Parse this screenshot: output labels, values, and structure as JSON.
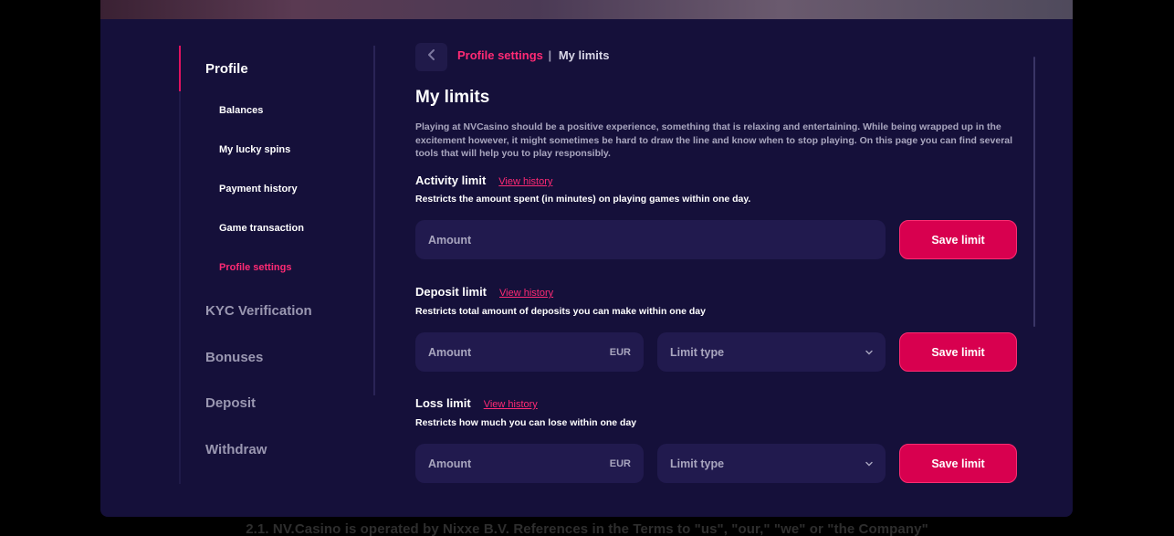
{
  "sidebar": {
    "profile": "Profile",
    "sub_items": [
      {
        "label": "Balances",
        "active": false
      },
      {
        "label": "My lucky spins",
        "active": false
      },
      {
        "label": "Payment history",
        "active": false
      },
      {
        "label": "Game transaction",
        "active": false
      },
      {
        "label": "Profile settings",
        "active": true
      }
    ],
    "main_items": [
      "KYC Verification",
      "Bonuses",
      "Deposit",
      "Withdraw"
    ]
  },
  "breadcrumb": {
    "parent": "Profile settings",
    "separator": "|",
    "current": "My limits"
  },
  "page": {
    "title": "My limits",
    "intro": "Playing at NVCasino should be a positive experience, something that is relaxing and entertaining. While being wrapped up in the excitement however, it might sometimes be hard to draw the line and know when to stop playing. On this page you can find several tools that will help you to play responsibly."
  },
  "sections": {
    "activity": {
      "title": "Activity limit",
      "history": "View history",
      "desc": "Restricts the amount spent (in minutes) on playing games within one day.",
      "amount_placeholder": "Amount",
      "save": "Save limit"
    },
    "deposit": {
      "title": "Deposit limit",
      "history": "View history",
      "desc": "Restricts total amount of deposits you can make within one day",
      "amount_placeholder": "Amount",
      "currency": "EUR",
      "limit_type": "Limit type",
      "save": "Save limit"
    },
    "loss": {
      "title": "Loss limit",
      "history": "View history",
      "desc": "Restricts how much you can lose within one day",
      "amount_placeholder": "Amount",
      "currency": "EUR",
      "limit_type": "Limit type",
      "save": "Save limit"
    }
  },
  "footer": {
    "text": "2.1. NV.Casino is operated by Nixxe B.V. References in the Terms to \"us\", \"our,\" \"we\" or \"the Company\""
  },
  "colors": {
    "accent": "#e0115f",
    "panel": "#15103a",
    "field": "#211a4e",
    "muted_text": "#9a97b1"
  },
  "icons": [
    "chevron-left-icon",
    "chevron-down-icon"
  ]
}
